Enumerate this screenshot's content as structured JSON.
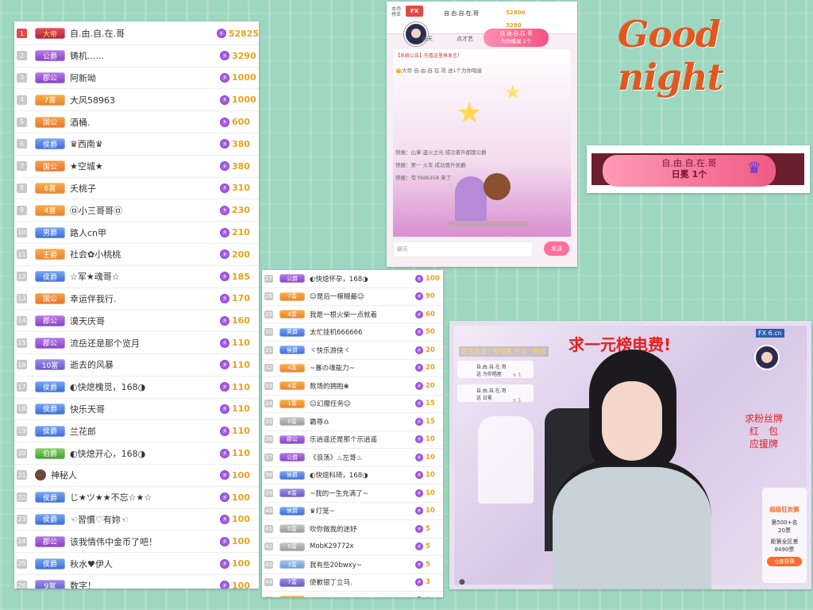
{
  "colors": {
    "accent": "#e54848",
    "gold": "#e9a21b",
    "purple": "#8842c6",
    "pink": "#ff5a8a",
    "greeting": "#e5561f"
  },
  "greeting": "Good night",
  "list1": [
    {
      "rank": "1",
      "badge": "大帝",
      "badge_type": "dadi",
      "name": "自.由.自.在.哥",
      "value": "52825"
    },
    {
      "rank": "2",
      "badge": "公爵",
      "badge_type": "gong",
      "name": "铸机......",
      "value": "3290"
    },
    {
      "rank": "3",
      "badge": "郡公",
      "badge_type": "gong",
      "name": "阿新呦",
      "value": "1000"
    },
    {
      "rank": "4",
      "badge": "7富",
      "badge_type": "rich",
      "name": "大风58963",
      "value": "1000"
    },
    {
      "rank": "5",
      "badge": "国公",
      "badge_type": "guo",
      "name": "酒桶.",
      "value": "600"
    },
    {
      "rank": "6",
      "badge": "侯爵",
      "badge_type": "hou",
      "name": "♛西南♛",
      "value": "380"
    },
    {
      "rank": "7",
      "badge": "国公",
      "badge_type": "guo",
      "name": "★空城★",
      "value": "380"
    },
    {
      "rank": "8",
      "badge": "6富",
      "badge_type": "rich",
      "name": "夭桃子",
      "value": "310"
    },
    {
      "rank": "9",
      "badge": "4富",
      "badge_type": "rich",
      "name": "㉤小三哥哥㉤",
      "value": "230"
    },
    {
      "rank": "10",
      "badge": "男爵",
      "badge_type": "hou",
      "name": "路人cn甲",
      "value": "210"
    },
    {
      "rank": "11",
      "badge": "王爵",
      "badge_type": "rich",
      "name": "社会✿小桃桃",
      "value": "200"
    },
    {
      "rank": "12",
      "badge": "侯爵",
      "badge_type": "hou",
      "name": "☆军★魂哥☆",
      "value": "185"
    },
    {
      "rank": "13",
      "badge": "国公",
      "badge_type": "guo",
      "name": "幸运伴我行.",
      "value": "170"
    },
    {
      "rank": "14",
      "badge": "郡公",
      "badge_type": "gong",
      "name": "漠天庆哥",
      "value": "160"
    },
    {
      "rank": "15",
      "badge": "郡公",
      "badge_type": "gong",
      "name": "流岳还是那个览月",
      "value": "110"
    },
    {
      "rank": "16",
      "badge": "10富",
      "badge_type": "fu",
      "name": "逝去的风暴",
      "value": "110"
    },
    {
      "rank": "17",
      "badge": "侯爵",
      "badge_type": "hou",
      "name": "◐快熄槐觅，168◑",
      "value": "110"
    },
    {
      "rank": "18",
      "badge": "侯爵",
      "badge_type": "hou",
      "name": "快乐天哥",
      "value": "110"
    },
    {
      "rank": "19",
      "badge": "侯爵",
      "badge_type": "hou",
      "name": "兰花郎",
      "value": "110"
    },
    {
      "rank": "20",
      "badge": "伯爵",
      "badge_type": "ye",
      "name": "◐快熄开心，168◑",
      "value": "110"
    },
    {
      "rank": "21",
      "badge": "",
      "badge_type": "avatar",
      "name": "神秘人",
      "value": "100"
    },
    {
      "rank": "22",
      "badge": "侯爵",
      "badge_type": "hou",
      "name": "じ★ツ★★不忘☆★☆",
      "value": "100"
    },
    {
      "rank": "23",
      "badge": "侯爵",
      "badge_type": "hou",
      "name": "☜習慣♡有妳☜",
      "value": "100"
    },
    {
      "rank": "24",
      "badge": "郡公",
      "badge_type": "gong",
      "name": "该我情伟中金币了吧！",
      "value": "100"
    },
    {
      "rank": "25",
      "badge": "侯爵",
      "badge_type": "hou",
      "name": "秋水♥伊人",
      "value": "100"
    },
    {
      "rank": "26",
      "badge": "9富",
      "badge_type": "fu",
      "name": "数字！",
      "value": "100"
    }
  ],
  "list2": [
    {
      "rank": "27",
      "badge": "公爵",
      "badge_type": "gong",
      "name": "◐快熄怀孕，168◑",
      "value": "100"
    },
    {
      "rank": "28",
      "badge": "7富",
      "badge_type": "rich",
      "name": "☺是后一模糊最☺",
      "value": "90"
    },
    {
      "rank": "29",
      "badge": "4富",
      "badge_type": "rich",
      "name": "我是一根火柴一点就着",
      "value": "60"
    },
    {
      "rank": "30",
      "badge": "男爵",
      "badge_type": "hou",
      "name": "太忙挂机666666",
      "value": "50"
    },
    {
      "rank": "31",
      "badge": "侯爵",
      "badge_type": "hou",
      "name": "ヾ快乐游侠ヾ",
      "value": "20"
    },
    {
      "rank": "32",
      "badge": "4富",
      "badge_type": "rich",
      "name": "~暴の魂能力~",
      "value": "20"
    },
    {
      "rank": "33",
      "badge": "4富",
      "badge_type": "rich",
      "name": "数场的拥抱❀",
      "value": "20"
    },
    {
      "rank": "34",
      "badge": "1富",
      "badge_type": "rich",
      "name": "☺幻魔任务☺",
      "value": "15"
    },
    {
      "rank": "35",
      "badge": "0富",
      "badge_type": "low",
      "name": "霸尊♎",
      "value": "15"
    },
    {
      "rank": "36",
      "badge": "郡公",
      "badge_type": "gong",
      "name": "乐逍遥还是那个乐逍遥",
      "value": "10"
    },
    {
      "rank": "37",
      "badge": "公爵",
      "badge_type": "gong",
      "name": "《浪荡》♨左哥♨",
      "value": "10"
    },
    {
      "rank": "38",
      "badge": "侯爵",
      "badge_type": "hou",
      "name": "◐快熄科琦，168◑",
      "value": "10"
    },
    {
      "rank": "39",
      "badge": "8富",
      "badge_type": "fu",
      "name": "~我的一生充满了~",
      "value": "10"
    },
    {
      "rank": "40",
      "badge": "侯爵",
      "badge_type": "hou",
      "name": "♛灯笼~",
      "value": "10"
    },
    {
      "rank": "41",
      "badge": "0富",
      "badge_type": "low",
      "name": "吹你做我的迷妤",
      "value": "5"
    },
    {
      "rank": "42",
      "badge": "0富",
      "badge_type": "low",
      "name": "MobK29772x",
      "value": "5"
    },
    {
      "rank": "43",
      "badge": "3富",
      "badge_type": "low2",
      "name": "我有些20bwxy~",
      "value": "5"
    },
    {
      "rank": "44",
      "badge": "7富",
      "badge_type": "fu",
      "name": "使歉银丁立马.",
      "value": "3"
    },
    {
      "rank": "45",
      "badge": "6富",
      "badge_type": "rich",
      "name": "✿杨海龙3u✿",
      "value": "3"
    }
  ],
  "live_top": {
    "tabs": [
      "聊天",
      "点才艺"
    ],
    "banner_name": "自.由.自.在.哥",
    "banner_sub": "为你模屋 1个",
    "rank_label": "本场榜单",
    "top_users": [
      {
        "name": "自.由.自.在.哥",
        "value": "52800"
      },
      {
        "name": "",
        "value": "3290"
      }
    ],
    "notice": "【系统公告】先看这里再发言！",
    "chat_lines": [
      "👑大帝 自.由.自.在.哥 送1个为你唱屋",
      "快报：山拿 盗火之光 成功晋升郡国公爵",
      "快报：第一 火车 成功晋升侯爵",
      "快报：夸 fdd6258 来了"
    ],
    "input_placeholder": "聊天",
    "send_label": "发送"
  },
  "banner_card": {
    "name": "自.由.自.在.哥",
    "sub": "日冕 1个"
  },
  "live_main": {
    "headline": "求一元榜电费!",
    "logo": "FX 6.cn",
    "ticker": "正在直播：你没来·不走一样的",
    "gift1_name": "自.由.自.在.哥",
    "gift1_sub": "送 为你唱屋",
    "gift1_count": "x 1",
    "gift2_name": "自.由.自.在.哥",
    "gift2_sub": "送 日冕",
    "gift2_count": "x 1",
    "side_text": [
      "求粉丝牌",
      "红　包",
      "应援牌"
    ],
    "promo_title": "超级狂欢赛",
    "promo_lines": [
      "第500+名",
      "20票",
      "距第全区差",
      "8490票"
    ],
    "promo_button": "立即投票"
  }
}
